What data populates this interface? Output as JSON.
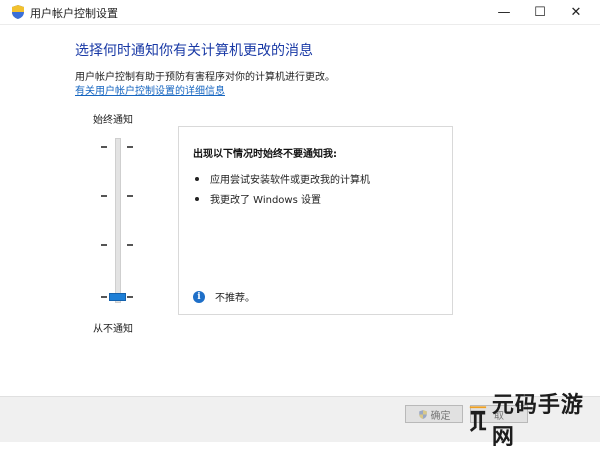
{
  "window": {
    "title": "用户帐户控制设置",
    "controls": {
      "minimize": "—",
      "maximize": "☐",
      "close": "✕"
    }
  },
  "main": {
    "heading": "选择何时通知你有关计算机更改的消息",
    "description": "用户帐户控制有助于预防有害程序对你的计算机进行更改。",
    "help_link": "有关用户帐户控制设置的详细信息"
  },
  "slider": {
    "top_label": "始终通知",
    "bottom_label": "从不通知",
    "levels": 4,
    "selected_level": 0
  },
  "info_panel": {
    "title": "出现以下情况时始终不要通知我:",
    "bullets": [
      "应用尝试安装软件或更改我的计算机",
      "我更改了 Windows 设置"
    ],
    "note": "不推荐。",
    "note_icon": "info-icon"
  },
  "footer": {
    "ok_label": "确定",
    "cancel_label": "取"
  },
  "watermark": {
    "text": "元码手游网"
  },
  "colors": {
    "heading": "#1a3aa6",
    "link": "#1565c0",
    "thumb": "#1e7fd6",
    "info": "#1e6fc8"
  }
}
